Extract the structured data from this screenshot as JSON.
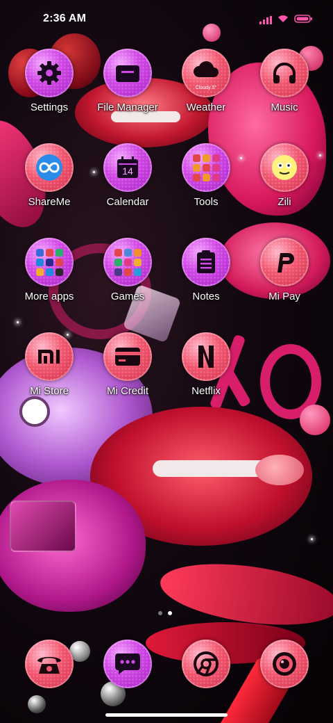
{
  "status_bar": {
    "time": "2:36 AM",
    "icons": [
      "signal-icon",
      "wifi-icon",
      "battery-icon"
    ],
    "accent": "#ff55aa"
  },
  "apps": [
    {
      "label": "Settings",
      "icon": "gear-icon",
      "style": "purple"
    },
    {
      "label": "File Manager",
      "icon": "folder-icon",
      "style": "purple"
    },
    {
      "label": "Weather",
      "icon": "cloud-icon",
      "style": "pink",
      "caption": "Cloudy 5°"
    },
    {
      "label": "Music",
      "icon": "headphones-icon",
      "style": "pink"
    },
    {
      "label": "ShareMe",
      "icon": "infinity-icon",
      "style": "pink"
    },
    {
      "label": "Calendar",
      "icon": "calendar-icon",
      "style": "purple",
      "caption": "14"
    },
    {
      "label": "Tools",
      "icon": "folder-grid-icon",
      "style": "purple"
    },
    {
      "label": "Zili",
      "icon": "zili-face-icon",
      "style": "pink"
    },
    {
      "label": "More apps",
      "icon": "folder-grid-icon",
      "style": "purple"
    },
    {
      "label": "Games",
      "icon": "folder-grid-icon",
      "style": "purple"
    },
    {
      "label": "Notes",
      "icon": "notes-icon",
      "style": "purple"
    },
    {
      "label": "Mi Pay",
      "icon": "mipay-icon",
      "style": "pink"
    },
    {
      "label": "Mi Store",
      "icon": "mi-logo-icon",
      "style": "pink"
    },
    {
      "label": "Mi Credit",
      "icon": "card-icon",
      "style": "pink"
    },
    {
      "label": "Netflix",
      "icon": "netflix-icon",
      "style": "pink"
    }
  ],
  "dock": [
    {
      "name": "phone",
      "icon": "telephone-icon",
      "style": "pink"
    },
    {
      "name": "messaging",
      "icon": "chat-bubble-icon",
      "style": "purple"
    },
    {
      "name": "chrome",
      "icon": "chrome-icon",
      "style": "pink"
    },
    {
      "name": "camera",
      "icon": "camera-lens-icon",
      "style": "pink"
    }
  ],
  "pages": {
    "count": 2,
    "active": 2
  }
}
